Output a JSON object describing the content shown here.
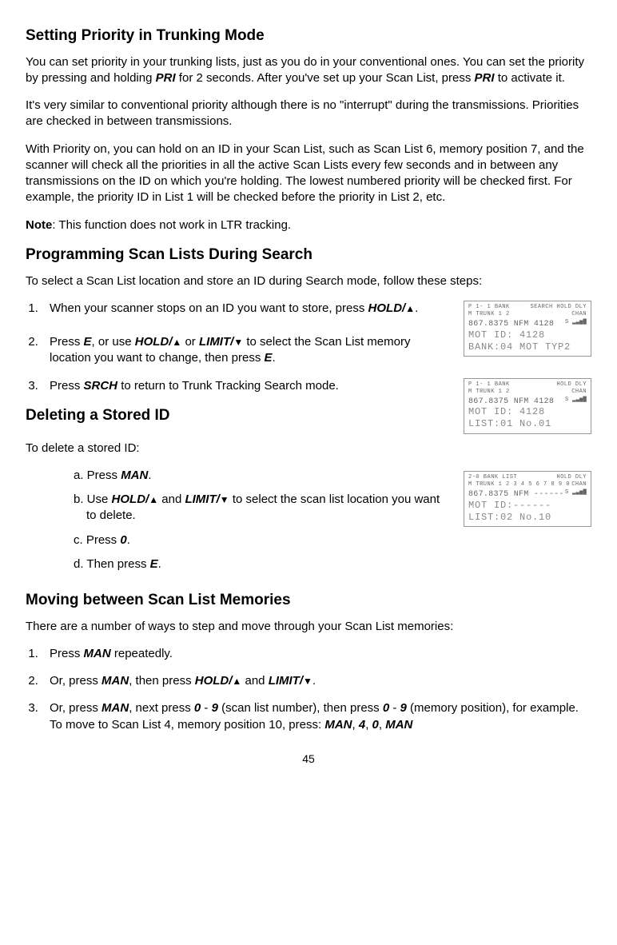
{
  "section1": {
    "heading": "Setting Priority in Trunking Mode",
    "p1a": "You can set priority in your trunking lists, just as you do in your conventional ones. You can set the priority by pressing and holding ",
    "p1_kw1": "PRI",
    "p1b": " for 2 seconds. After you've set up your Scan List, press ",
    "p1_kw2": "PRI",
    "p1c": " to activate it.",
    "p2": "It's very similar to conventional priority although there is no \"interrupt\" during the transmissions. Priorities are checked in between transmissions.",
    "p3": "With Priority on, you can hold on an ID in your Scan List, such as Scan List 6, memory position 7, and the scanner will check all the priorities in all the active Scan Lists every few seconds and in between any transmissions on the ID on which you're holding. The lowest numbered priority will be checked first. For example, the priority ID in List 1 will be checked before the priority in List 2, etc.",
    "note_label": "Note",
    "note_text": ":  This function does not work in LTR tracking."
  },
  "section2": {
    "heading": "Programming Scan Lists During Search",
    "intro": "To select a Scan List location and store an ID during Search mode, follow these steps:",
    "step1a": "When your scanner stops on an ID you want to store, press ",
    "step1_kw": "HOLD/",
    "step1b": ".",
    "step2a": "Press ",
    "step2_kw1": "E",
    "step2b": ", or use ",
    "step2_kw2": "HOLD/",
    "step2c": " or ",
    "step2_kw3": "LIMIT/",
    "step2d": " to select the Scan List memory location you want to change, then press ",
    "step2_kw4": "E",
    "step2e": ".",
    "step3a": "Press ",
    "step3_kw": "SRCH",
    "step3b": " to return to Trunk Tracking Search mode."
  },
  "section3": {
    "heading": "Deleting a Stored ID",
    "intro": "To delete a stored ID:",
    "a_pre": "a. Press ",
    "a_kw": "MAN",
    "a_post": ".",
    "b_pre": "b. Use ",
    "b_kw1": "HOLD/",
    "b_mid": " and ",
    "b_kw2": "LIMIT/",
    "b_post": " to select the scan list location you want to delete.",
    "c_pre": "c. Press ",
    "c_kw": "0",
    "c_post": ".",
    "d_pre": "d. Then press ",
    "d_kw": "E",
    "d_post": "."
  },
  "section4": {
    "heading": "Moving between Scan List Memories",
    "intro": "There are a number of ways to step and move through your Scan List memories:",
    "s1a": "Press ",
    "s1_kw": "MAN",
    "s1b": " repeatedly.",
    "s2a": "Or, press ",
    "s2_kw1": "MAN",
    "s2b": ", then press ",
    "s2_kw2": "HOLD/",
    "s2c": " and ",
    "s2_kw3": "LIMIT/",
    "s2d": ".",
    "s3a": "Or, press ",
    "s3_kw1": "MAN",
    "s3b": ", next press ",
    "s3_kw2": "0",
    "s3c": " - ",
    "s3_kw3": "9",
    "s3d": " (scan list number), then press ",
    "s3_kw4": "0",
    "s3e": " - ",
    "s3_kw5": "9",
    "s3f": " (memory position), for example. To move to Scan List 4, memory position 10, press: ",
    "s3_kw6": "MAN",
    "s3g": ", ",
    "s3_kw7": "4",
    "s3h": ", ",
    "s3_kw8": "0",
    "s3i": ", ",
    "s3_kw9": "MAN"
  },
  "lcd1": {
    "r1_left": "P  1- 1 BANK",
    "r1_right": "SEARCH  HOLD      DLY",
    "r2": " M   TRUNK  1 2",
    "r2b": "CHAN",
    "r3_left": "867.8375 NFM  4128",
    "r3_right": "S ▂▃▅▇",
    "r4": "MOT ID:  4128",
    "r5": "BANK:04 MOT TYP2"
  },
  "lcd2": {
    "r1_left": "P  1- 1 BANK",
    "r1_right": "HOLD      DLY",
    "r2": " M   TRUNK  1 2",
    "r2b": "CHAN",
    "r3_left": "867.8375 NFM  4128",
    "r3_right": "S ▂▃▅▇",
    "r4": "MOT ID:  4128",
    "r5": "LIST:01 No.01"
  },
  "lcd3": {
    "r1_left": "   2-0 BANK  LIST",
    "r1_right": "HOLD      DLY",
    "r2": " M   TRUNK  1 2 3 4 5 6 7 8 9 0",
    "r2b": "CHAN",
    "r3_left": "867.8375 NFM ------",
    "r3_right": "S ▂▃▅▇",
    "r4": "MOT ID:------",
    "r5": "LIST:02 No.10"
  },
  "page_number": "45"
}
